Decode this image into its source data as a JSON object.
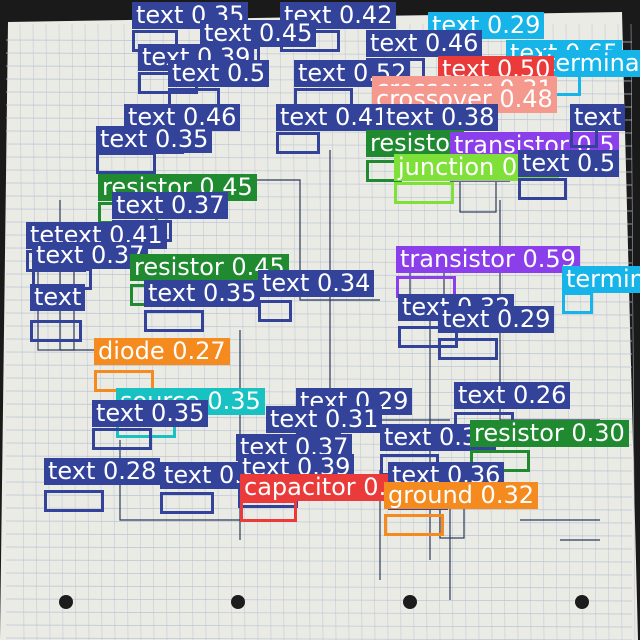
{
  "colors": {
    "paper": "#ebebe6",
    "grid": "#b9c4d2",
    "ink": "#2b3a5a",
    "background": "#1a1a1a"
  },
  "detections": [
    {
      "text": "text 0.35",
      "cls": "text"
    },
    {
      "text": "text 0.42",
      "cls": "text"
    },
    {
      "text": "text 0.29",
      "cls": "cyan"
    },
    {
      "text": "text 0.45",
      "cls": "text"
    },
    {
      "text": "text 0.46",
      "cls": "text"
    },
    {
      "text": "text 0.39",
      "cls": "text"
    },
    {
      "text": "text 0.65",
      "cls": "cyan"
    },
    {
      "text": "terminal",
      "cls": "cyan"
    },
    {
      "text": "text 0.5",
      "cls": "text"
    },
    {
      "text": "text 0.52",
      "cls": "text"
    },
    {
      "text": "text 0.50",
      "cls": "red"
    },
    {
      "text": "crossover 0.31",
      "cls": "pink"
    },
    {
      "text": "crossover 0.48",
      "cls": "pink"
    },
    {
      "text": "text 0.46",
      "cls": "text"
    },
    {
      "text": "text 0.41",
      "cls": "text"
    },
    {
      "text": "text 0.38",
      "cls": "text"
    },
    {
      "text": "text 0.35",
      "cls": "text"
    },
    {
      "text": "resistor",
      "cls": "green"
    },
    {
      "text": "transistor 0.5",
      "cls": "purple"
    },
    {
      "text": "junction 0.25",
      "cls": "lime"
    },
    {
      "text": "text 0.5",
      "cls": "text"
    },
    {
      "text": "text",
      "cls": "text"
    },
    {
      "text": "resistor 0.45",
      "cls": "green"
    },
    {
      "text": "text 0.37",
      "cls": "text"
    },
    {
      "text": "tetext 0.41",
      "cls": "text"
    },
    {
      "text": "text 0.37",
      "cls": "text"
    },
    {
      "text": "resistor 0.45",
      "cls": "green"
    },
    {
      "text": "text 0.34",
      "cls": "text"
    },
    {
      "text": "text 0.35",
      "cls": "text"
    },
    {
      "text": "text",
      "cls": "text"
    },
    {
      "text": "transistor 0.59",
      "cls": "purple"
    },
    {
      "text": "terminal",
      "cls": "cyan"
    },
    {
      "text": "text 0.32",
      "cls": "text"
    },
    {
      "text": "text 0.29",
      "cls": "text"
    },
    {
      "text": "diode 0.27",
      "cls": "orange"
    },
    {
      "text": "source 0.35",
      "cls": "teal"
    },
    {
      "text": "text 0.35",
      "cls": "text"
    },
    {
      "text": "text 0.29",
      "cls": "text"
    },
    {
      "text": "text 0.31",
      "cls": "text"
    },
    {
      "text": "text 0.26",
      "cls": "text"
    },
    {
      "text": "text 0.37",
      "cls": "text"
    },
    {
      "text": "text 0.32",
      "cls": "text"
    },
    {
      "text": "resistor 0.30",
      "cls": "green"
    },
    {
      "text": "text 0.28",
      "cls": "text"
    },
    {
      "text": "text 0.39",
      "cls": "text"
    },
    {
      "text": "text 0.39",
      "cls": "text"
    },
    {
      "text": "capacitor 0.29",
      "cls": "red"
    },
    {
      "text": "text 0.36",
      "cls": "text"
    },
    {
      "text": "ground 0.32",
      "cls": "orange"
    }
  ]
}
